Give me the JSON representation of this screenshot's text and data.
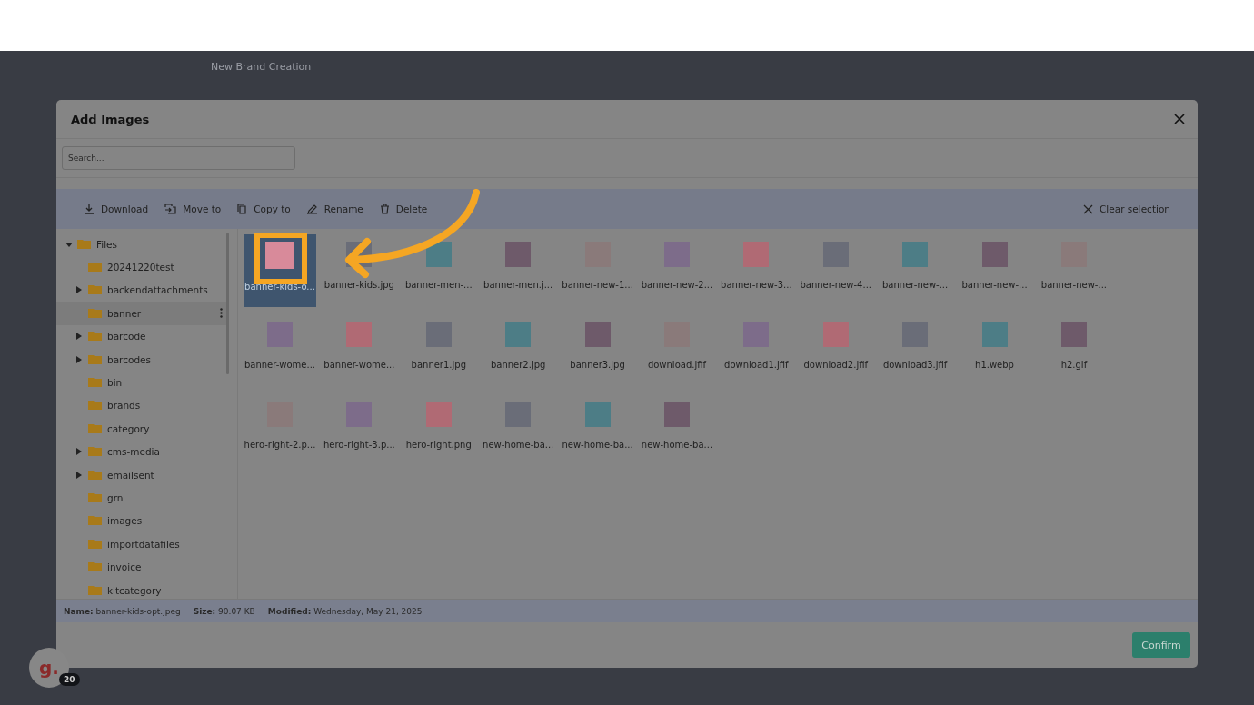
{
  "app": {
    "page_title": "New Brand Creation"
  },
  "dialog": {
    "title": "Add Images",
    "search": {
      "placeholder": "Search..."
    },
    "toolbar": [
      {
        "label": "Download",
        "kind": "download"
      },
      {
        "label": "Move to",
        "kind": "move"
      },
      {
        "label": "Copy to",
        "kind": "copy"
      },
      {
        "label": "Rename",
        "kind": "rename"
      },
      {
        "label": "Delete",
        "kind": "delete"
      }
    ],
    "clear_selection": "Clear selection",
    "tree": {
      "label": "Files",
      "expanded": true,
      "children": [
        {
          "label": "20241220test",
          "expandable": false,
          "selected": false
        },
        {
          "label": "backendattachments",
          "expandable": true,
          "selected": false
        },
        {
          "label": "banner",
          "expandable": false,
          "selected": true
        },
        {
          "label": "barcode",
          "expandable": true,
          "selected": false
        },
        {
          "label": "barcodes",
          "expandable": true,
          "selected": false
        },
        {
          "label": "bin",
          "expandable": false,
          "selected": false
        },
        {
          "label": "brands",
          "expandable": false,
          "selected": false
        },
        {
          "label": "category",
          "expandable": false,
          "selected": false
        },
        {
          "label": "cms-media",
          "expandable": true,
          "selected": false
        },
        {
          "label": "emailsent",
          "expandable": true,
          "selected": false
        },
        {
          "label": "grn",
          "expandable": false,
          "selected": false
        },
        {
          "label": "images",
          "expandable": false,
          "selected": false
        },
        {
          "label": "importdatafiles",
          "expandable": false,
          "selected": false
        },
        {
          "label": "invoice",
          "expandable": false,
          "selected": false
        },
        {
          "label": "kitcategory",
          "expandable": false,
          "selected": false
        }
      ]
    },
    "files": [
      {
        "name": "banner-kids-o...",
        "selected": true
      },
      {
        "name": "banner-kids.jpg",
        "selected": false
      },
      {
        "name": "banner-men-...",
        "selected": false
      },
      {
        "name": "banner-men.j...",
        "selected": false
      },
      {
        "name": "banner-new-1...",
        "selected": false
      },
      {
        "name": "banner-new-2...",
        "selected": false
      },
      {
        "name": "banner-new-3...",
        "selected": false
      },
      {
        "name": "banner-new-4...",
        "selected": false
      },
      {
        "name": "banner-new-...",
        "selected": false
      },
      {
        "name": "banner-new-...",
        "selected": false
      },
      {
        "name": "banner-new-...",
        "selected": false
      },
      {
        "name": "banner-wome...",
        "selected": false
      },
      {
        "name": "banner-wome...",
        "selected": false
      },
      {
        "name": "banner1.jpg",
        "selected": false
      },
      {
        "name": "banner2.jpg",
        "selected": false
      },
      {
        "name": "banner3.jpg",
        "selected": false
      },
      {
        "name": "download.jfif",
        "selected": false
      },
      {
        "name": "download1.jfif",
        "selected": false
      },
      {
        "name": "download2.jfif",
        "selected": false
      },
      {
        "name": "download3.jfif",
        "selected": false
      },
      {
        "name": "h1.webp",
        "selected": false
      },
      {
        "name": "h2.gif",
        "selected": false
      },
      {
        "name": "hero-right-2.p...",
        "selected": false
      },
      {
        "name": "hero-right-3.p...",
        "selected": false
      },
      {
        "name": "hero-right.png",
        "selected": false
      },
      {
        "name": "new-home-ba...",
        "selected": false
      },
      {
        "name": "new-home-ba...",
        "selected": false
      },
      {
        "name": "new-home-ba...",
        "selected": false
      }
    ],
    "details": [
      {
        "label": "Name:",
        "value": "banner-kids-opt.jpeg"
      },
      {
        "label": "Size:",
        "value": "90.07 KB"
      },
      {
        "label": "Modified:",
        "value": "Wednesday, May 21, 2025"
      }
    ],
    "confirm": "Confirm"
  },
  "guide": {
    "logo": "g.",
    "count": "20"
  }
}
